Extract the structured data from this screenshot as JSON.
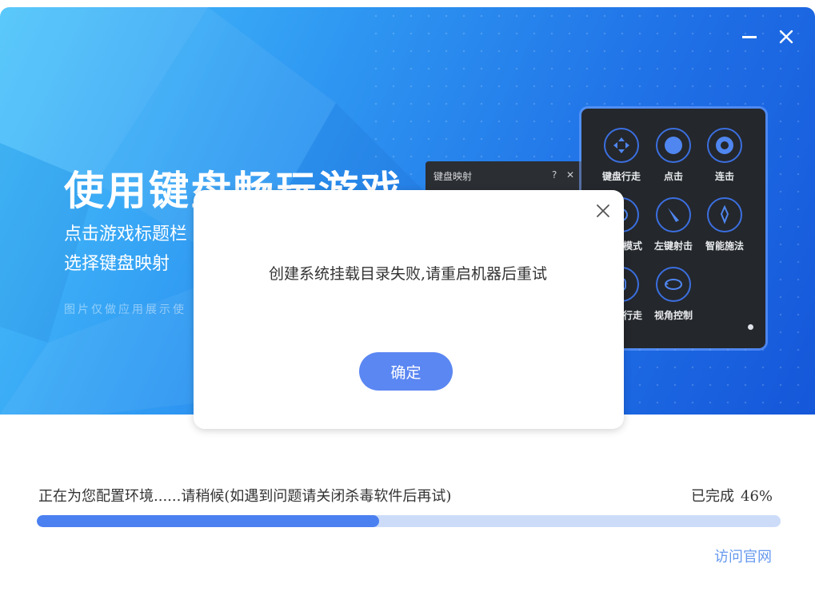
{
  "banner": {
    "headline": "使用键盘畅玩游戏",
    "sub_line1": "点击游戏标题栏",
    "sub_line2": "选择键盘映射",
    "note": "图片仅做应用展示使",
    "mini_panel_title": "键盘映射",
    "mini_panel_help": "?",
    "mini_panel_close": "✕",
    "features": [
      {
        "label": "键盘行走",
        "icon": "dpad-icon"
      },
      {
        "label": "点击",
        "icon": "tap-icon"
      },
      {
        "label": "连击",
        "icon": "combo-icon"
      },
      {
        "label": "模式",
        "icon": "mode-icon"
      },
      {
        "label": "左键射击",
        "icon": "shoot-icon"
      },
      {
        "label": "智能施法",
        "icon": "cast-icon"
      },
      {
        "label": "行走",
        "icon": "walk-icon"
      },
      {
        "label": "视角控制",
        "icon": "view-rotate-icon"
      }
    ]
  },
  "window_controls": {
    "minimize": "minimize-icon",
    "close": "close-icon"
  },
  "dialog": {
    "message": "创建系统挂载目录失败,请重启机器后重试",
    "ok_label": "确定"
  },
  "progress": {
    "status_text": "正在为您配置环境......请稍候(如遇到问题请关闭杀毒软件后再试)",
    "done_label": "已完成",
    "percent_text": "46%",
    "fraction": 0.46
  },
  "footer": {
    "visit_link": "访问官网"
  },
  "colors": {
    "accent": "#4b80f0",
    "track": "#ccdcf8",
    "link": "#6699ee",
    "button": "#5b87f2"
  }
}
